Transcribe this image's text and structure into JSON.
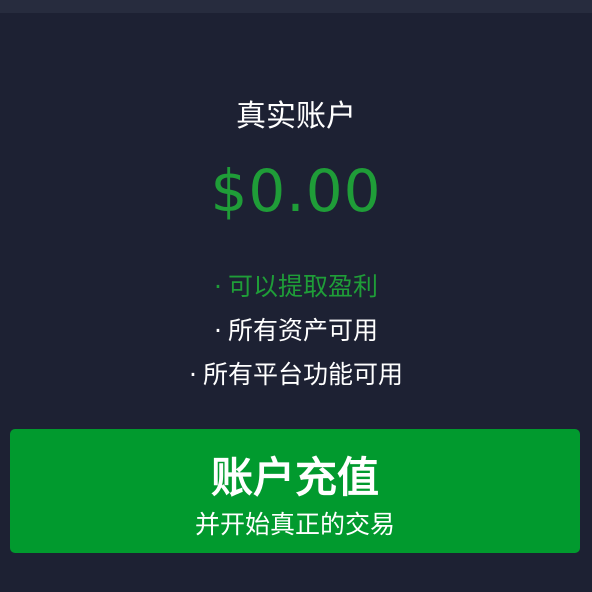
{
  "account": {
    "title": "真实账户",
    "balance": "$0.00"
  },
  "features": [
    {
      "bullet": "·",
      "text": "可以提取盈利",
      "color": "#1f9d38"
    },
    {
      "bullet": "·",
      "text": "所有资产可用",
      "color": "#ffffff"
    },
    {
      "bullet": "·",
      "text": "所有平台功能可用",
      "color": "#ffffff"
    }
  ],
  "deposit_button": {
    "label": "账户充值",
    "sublabel": "并开始真正的交易",
    "color": "#019a2e"
  },
  "colors": {
    "background": "#1d2133",
    "accent": "#1f9d38"
  }
}
